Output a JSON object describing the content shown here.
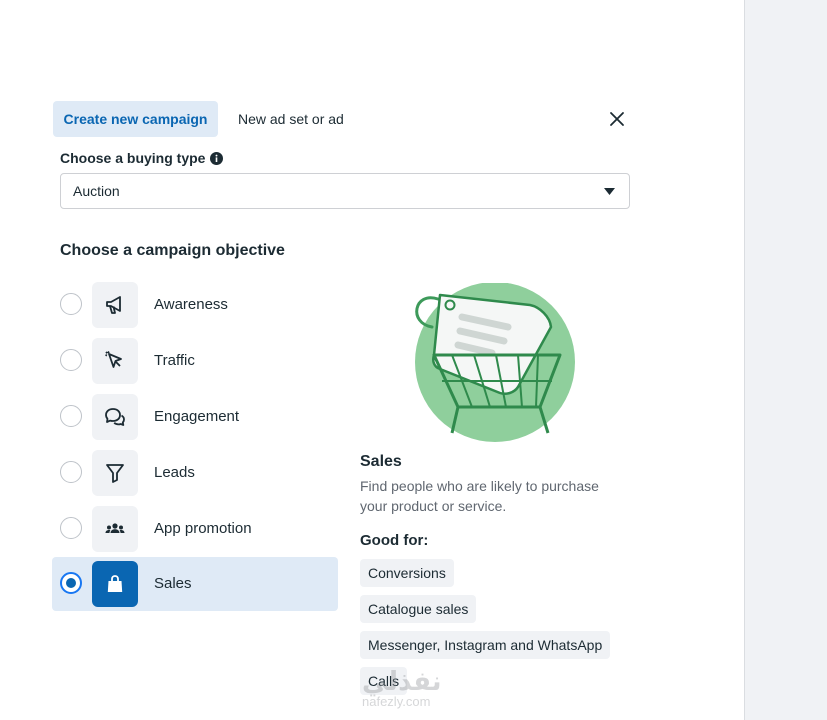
{
  "tabs": {
    "create_new": "Create new campaign",
    "new_ad_set": "New ad set or ad"
  },
  "buying_type": {
    "label": "Choose a buying type",
    "selected": "Auction"
  },
  "objective": {
    "heading": "Choose a campaign objective",
    "items": [
      {
        "label": "Awareness",
        "icon": "megaphone-icon"
      },
      {
        "label": "Traffic",
        "icon": "cursor-icon"
      },
      {
        "label": "Engagement",
        "icon": "chat-bubbles-icon"
      },
      {
        "label": "Leads",
        "icon": "funnel-icon"
      },
      {
        "label": "App promotion",
        "icon": "people-icon"
      },
      {
        "label": "Sales",
        "icon": "shopping-bag-icon"
      }
    ],
    "selected_index": 5
  },
  "detail": {
    "title": "Sales",
    "description": "Find people who are likely to purchase your product or service.",
    "good_for_heading": "Good for:",
    "tags": [
      "Conversions",
      "Catalogue sales",
      "Messenger, Instagram and WhatsApp",
      "Calls"
    ]
  },
  "watermark": {
    "arabic": "نفذلي",
    "latin": "nafezly.com"
  },
  "colors": {
    "accent": "#0a66b2",
    "selected_bg": "#dfeaf6",
    "illustration_green": "#8fcf9c"
  }
}
